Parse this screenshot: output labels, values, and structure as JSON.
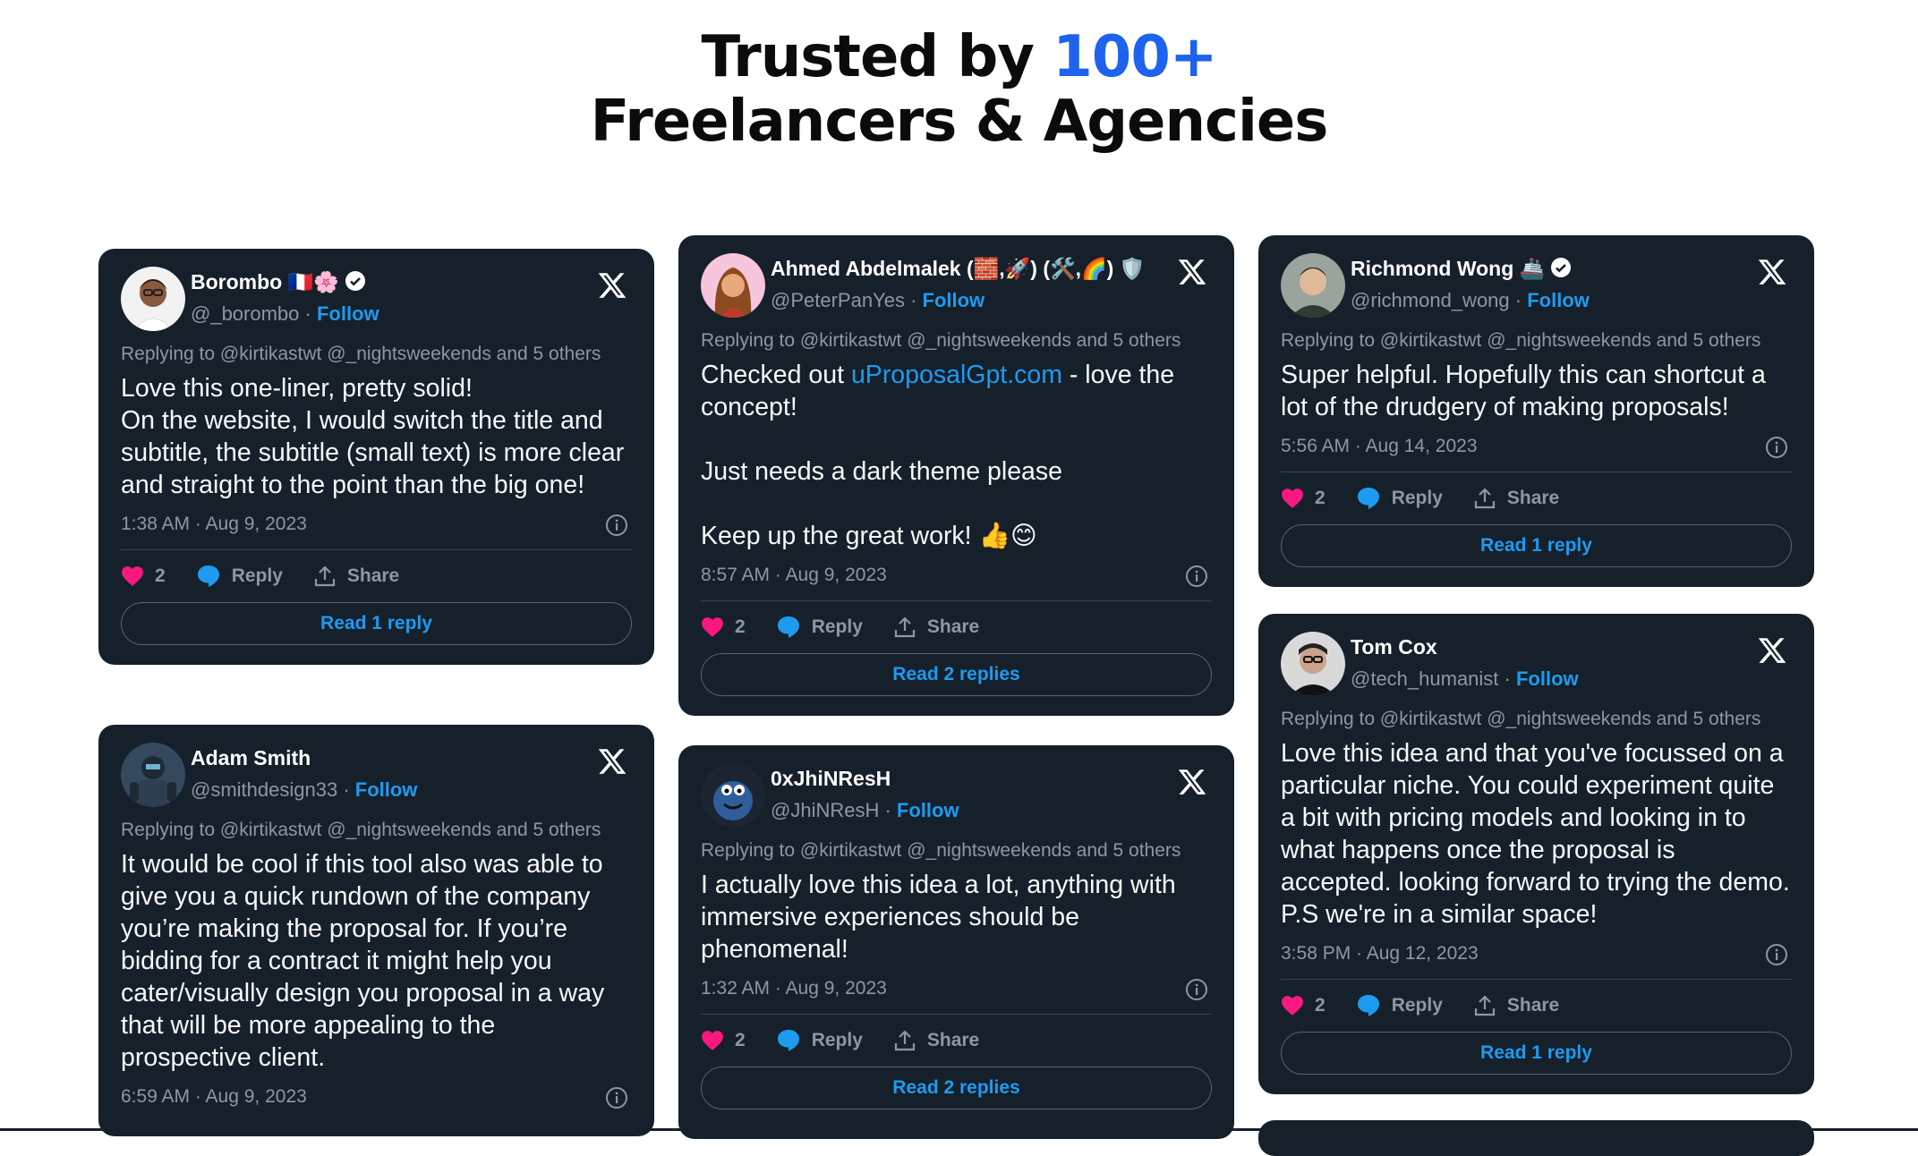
{
  "heading": {
    "line1_prefix": "Trusted by ",
    "line1_accent": "100+",
    "line2": "Freelancers & Agencies",
    "accent_color": "#1d63ed"
  },
  "colors": {
    "card_bg": "#15202b",
    "link": "#1d9bf0",
    "heart": "#f91880",
    "muted": "#8b98a5"
  },
  "tweets": [
    {
      "name": "Borombo 🇫🇷🌸",
      "verified": true,
      "handle": "@_borombo",
      "follow": "Follow",
      "replying": "Replying to @kirtikastwt @_nightsweekends and 5 others",
      "text": "Love this one-liner, pretty solid!\nOn the website, I would switch the title and subtitle, the subtitle (small text) is more clear and straight to the point than the big one!",
      "time": "1:38 AM · Aug 9, 2023",
      "likes": "2",
      "reply_label": "Reply",
      "share_label": "Share",
      "read_label": "Read 1 reply",
      "avatar_icon": "memoji-avatar"
    },
    {
      "name": "Adam Smith",
      "verified": false,
      "handle": "@smithdesign33",
      "follow": "Follow",
      "replying": "Replying to @kirtikastwt @_nightsweekends and 5 others",
      "text": "It would be cool if this tool also was able to give you a quick rundown of the company you’re making the proposal for. If you’re bidding for a contract it might help you cater/visually design you proposal in a way that will be more appealing to the prospective client.",
      "time": "6:59 AM · Aug 9, 2023",
      "avatar_icon": "robot-avatar"
    },
    {
      "name": "Ahmed Abdelmalek (🧱,🚀) (🛠️,🌈) 🛡️",
      "verified": false,
      "handle": "@PeterPanYes",
      "follow": "Follow",
      "replying": "Replying to @kirtikastwt @_nightsweekends and 5 others",
      "text_before_link": "Checked out ",
      "link_text": "uProposalGpt.com",
      "text_after_link": " - love the concept!\n\nJust needs a dark theme please\n\nKeep up the great work! 👍😊",
      "time": "8:57 AM · Aug 9, 2023",
      "likes": "2",
      "reply_label": "Reply",
      "share_label": "Share",
      "read_label": "Read 2 replies",
      "avatar_icon": "illustrated-avatar"
    },
    {
      "name": "0xJhiNResH",
      "verified": false,
      "handle": "@JhiNResH",
      "follow": "Follow",
      "replying": "Replying to @kirtikastwt @_nightsweekends and 5 others",
      "text": "I actually love this idea a lot, anything with immersive experiences should be phenomenal!",
      "time": "1:32 AM · Aug 9, 2023",
      "likes": "2",
      "reply_label": "Reply",
      "share_label": "Share",
      "read_label": "Read 2 replies",
      "avatar_icon": "monster-avatar"
    },
    {
      "name": "Richmond Wong 🚢",
      "verified": true,
      "handle": "@richmond_wong",
      "follow": "Follow",
      "replying": "Replying to @kirtikastwt @_nightsweekends and 5 others",
      "text": "Super helpful. Hopefully this can shortcut a lot of the drudgery of making proposals!",
      "time": "5:56 AM · Aug 14, 2023",
      "likes": "2",
      "reply_label": "Reply",
      "share_label": "Share",
      "read_label": "Read 1 reply",
      "avatar_icon": "photo-avatar"
    },
    {
      "name": "Tom Cox",
      "verified": false,
      "handle": "@tech_humanist",
      "follow": "Follow",
      "replying": "Replying to @kirtikastwt @_nightsweekends and 5 others",
      "text": "Love this idea and that you've focussed on a particular niche. You could experiment quite a bit with pricing models and looking in to what happens once the proposal is accepted. looking forward to trying the demo. P.S we're in a similar space!",
      "time": "3:58 PM · Aug 12, 2023",
      "likes": "2",
      "reply_label": "Reply",
      "share_label": "Share",
      "read_label": "Read 1 reply",
      "avatar_icon": "photo-avatar"
    }
  ]
}
